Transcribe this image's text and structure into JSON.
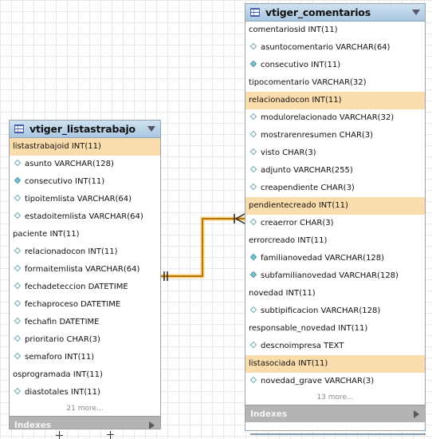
{
  "tables": {
    "listastrabajo": {
      "name": "vtiger_listastrabajo",
      "columns": [
        {
          "text": "listastrabajoid INT(11)",
          "marker": "none",
          "highlight": true
        },
        {
          "text": "asunto VARCHAR(128)",
          "marker": "open",
          "highlight": false
        },
        {
          "text": "consecutivo INT(11)",
          "marker": "fill",
          "highlight": false
        },
        {
          "text": "tipoitemlista VARCHAR(64)",
          "marker": "open",
          "highlight": false
        },
        {
          "text": "estadoitemlista VARCHAR(64)",
          "marker": "open",
          "highlight": false
        },
        {
          "text": "paciente INT(11)",
          "marker": "none",
          "highlight": false
        },
        {
          "text": "relacionadocon INT(11)",
          "marker": "open",
          "highlight": false
        },
        {
          "text": "formaitemlista VARCHAR(64)",
          "marker": "open",
          "highlight": false
        },
        {
          "text": "fechadeteccion DATETIME",
          "marker": "open",
          "highlight": false
        },
        {
          "text": "fechaproceso DATETIME",
          "marker": "open",
          "highlight": false
        },
        {
          "text": "fechafin DATETIME",
          "marker": "open",
          "highlight": false
        },
        {
          "text": "prioritario CHAR(3)",
          "marker": "open",
          "highlight": false
        },
        {
          "text": "semaforo INT(11)",
          "marker": "open",
          "highlight": false
        },
        {
          "text": "osprogramada INT(11)",
          "marker": "none",
          "highlight": false
        },
        {
          "text": "diastotales INT(11)",
          "marker": "open",
          "highlight": false
        }
      ],
      "more": "21 more...",
      "footer": "Indexes"
    },
    "comentarios": {
      "name": "vtiger_comentarios",
      "columns": [
        {
          "text": "comentariosid INT(11)",
          "marker": "none",
          "highlight": false
        },
        {
          "text": "asuntocomentario VARCHAR(64)",
          "marker": "open",
          "highlight": false
        },
        {
          "text": "consecutivo INT(11)",
          "marker": "fill",
          "highlight": false
        },
        {
          "text": "tipocomentario VARCHAR(32)",
          "marker": "none",
          "highlight": false
        },
        {
          "text": "relacionadocon INT(11)",
          "marker": "none",
          "highlight": true
        },
        {
          "text": "modulorelacionado VARCHAR(32)",
          "marker": "open",
          "highlight": false
        },
        {
          "text": "mostrarenresumen CHAR(3)",
          "marker": "open",
          "highlight": false
        },
        {
          "text": "visto CHAR(3)",
          "marker": "open",
          "highlight": false
        },
        {
          "text": "adjunto VARCHAR(255)",
          "marker": "open",
          "highlight": false
        },
        {
          "text": "creapendiente CHAR(3)",
          "marker": "open",
          "highlight": false
        },
        {
          "text": "pendientecreado INT(11)",
          "marker": "none",
          "highlight": true
        },
        {
          "text": "creaerror CHAR(3)",
          "marker": "open",
          "highlight": false
        },
        {
          "text": "errorcreado INT(11)",
          "marker": "none",
          "highlight": false
        },
        {
          "text": "familianovedad VARCHAR(128)",
          "marker": "fill",
          "highlight": false
        },
        {
          "text": "subfamilianovedad VARCHAR(128)",
          "marker": "fill",
          "highlight": false
        },
        {
          "text": "novedad INT(11)",
          "marker": "none",
          "highlight": false
        },
        {
          "text": "subtipificacion VARCHAR(128)",
          "marker": "open",
          "highlight": false
        },
        {
          "text": "responsable_novedad INT(11)",
          "marker": "none",
          "highlight": false
        },
        {
          "text": "descnoimpresa TEXT",
          "marker": "open",
          "highlight": false
        },
        {
          "text": "listasociada INT(11)",
          "marker": "none",
          "highlight": true
        },
        {
          "text": "novedad_grave VARCHAR(3)",
          "marker": "open",
          "highlight": false
        }
      ],
      "more": "13 more...",
      "footer": "Indexes"
    }
  },
  "relationship": {
    "from": "vtiger_listastrabajo",
    "to": "vtiger_comentarios",
    "line_color": "#c98a1c"
  }
}
